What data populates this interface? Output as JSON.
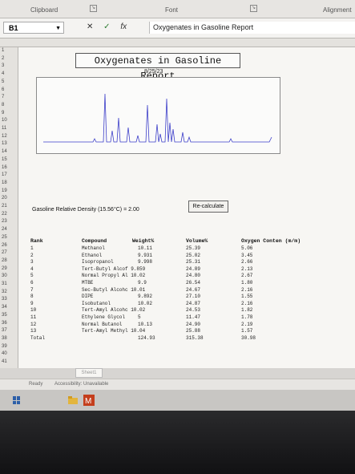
{
  "ribbon": {
    "clipboard": "Clipboard",
    "font": "Font",
    "alignment": "Alignment"
  },
  "formula_bar": {
    "cell_ref": "B1",
    "cancel_symbol": "✕",
    "confirm_symbol": "✓",
    "fx": "fx",
    "content": "Oxygenates in Gasoline Report"
  },
  "report": {
    "title": "Oxygenates in Gasoline Report",
    "date": "8/25/23",
    "density_label": "Gasoline Relative Density (15.56°C) = 2.00",
    "recalc_label": "Re-calculate",
    "headers": {
      "rank": "Rank",
      "compound": "Compound",
      "weight": "Weight%",
      "volume": "Volume%",
      "oxygen": "Oxygen Conten (m/m)"
    },
    "rows": [
      {
        "rank": "1",
        "compound": "Methanol",
        "weight": "10.11",
        "volume": "25.39",
        "oxygen": "5.06"
      },
      {
        "rank": "2",
        "compound": "Ethanol",
        "weight": "9.931",
        "volume": "25.02",
        "oxygen": "3.45"
      },
      {
        "rank": "3",
        "compound": "Isopropanol",
        "weight": "9.998",
        "volume": "25.31",
        "oxygen": "2.66"
      },
      {
        "rank": "4",
        "compound": "Tert-Butyl Alcof 9.859",
        "weight": "",
        "volume": "24.89",
        "oxygen": "2.13"
      },
      {
        "rank": "5",
        "compound": "Normal Propyl Al 10.02",
        "weight": "",
        "volume": "24.80",
        "oxygen": "2.67"
      },
      {
        "rank": "6",
        "compound": "MTBE",
        "weight": "9.9",
        "volume": "26.54",
        "oxygen": "1.80"
      },
      {
        "rank": "7",
        "compound": "Sec-Butyl Alcohc 10.01",
        "weight": "",
        "volume": "24.67",
        "oxygen": "2.16"
      },
      {
        "rank": "8",
        "compound": "DIPE",
        "weight": "9.892",
        "volume": "27.10",
        "oxygen": "1.55"
      },
      {
        "rank": "9",
        "compound": "Isobutanol",
        "weight": "10.02",
        "volume": "24.87",
        "oxygen": "2.16"
      },
      {
        "rank": "10",
        "compound": "Tert-Amyl Alcohc 10.02",
        "weight": "",
        "volume": "24.53",
        "oxygen": "1.82"
      },
      {
        "rank": "11",
        "compound": "Ethylene Glycol",
        "weight": "5",
        "volume": "11.47",
        "oxygen": "1.78"
      },
      {
        "rank": "12",
        "compound": "Normal Butanol",
        "weight": "10.13",
        "volume": "24.90",
        "oxygen": "2.19"
      },
      {
        "rank": "13",
        "compound": "Tert-Amyl Methyl 10.04",
        "weight": "",
        "volume": "25.88",
        "oxygen": "1.57"
      },
      {
        "rank": "Total",
        "compound": "",
        "weight": "124.93",
        "volume": "315.38",
        "oxygen": "30.98"
      }
    ]
  },
  "row_numbers": [
    "1",
    "2",
    "3",
    "4",
    "5",
    "6",
    "7",
    "8",
    "9",
    "10",
    "11",
    "12",
    "13",
    "14",
    "15",
    "16",
    "17",
    "18",
    "19",
    "20",
    "21",
    "22",
    "23",
    "24",
    "25",
    "26",
    "27",
    "28",
    "29",
    "30",
    "31",
    "32",
    "33",
    "34",
    "35",
    "36",
    "37",
    "38",
    "39",
    "40",
    "41"
  ],
  "sheet_tab": "Sheet1",
  "status": {
    "ready": "Ready",
    "accessibility": "Accessibility: Unavailable"
  },
  "colors": {
    "chromatogram": "#3d3fc9",
    "grid_border": "#8a8a8a"
  },
  "icons": [
    "windows-logo-icon",
    "file-explorer-icon",
    "office-app-icon"
  ]
}
